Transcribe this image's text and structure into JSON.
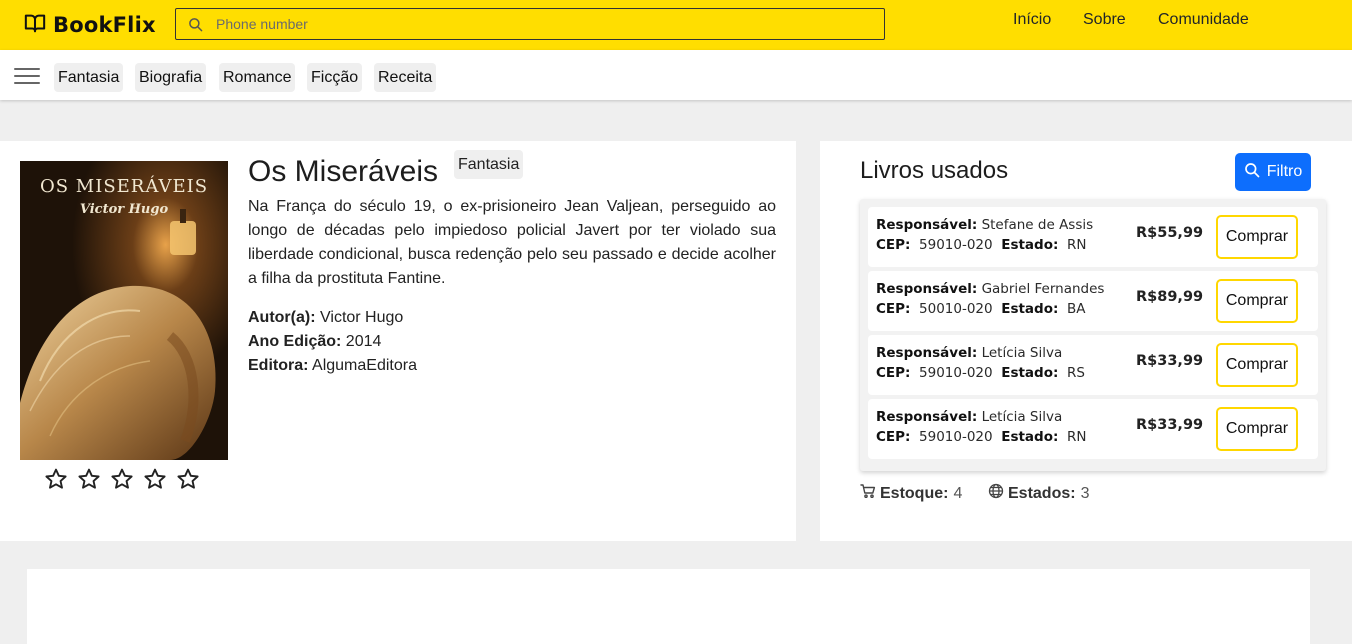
{
  "app": {
    "name": "BookFlix",
    "logo_icon": "book-open-icon"
  },
  "search": {
    "placeholder": "Phone number",
    "icon": "search-icon"
  },
  "topnav": [
    "Início",
    "Sobre",
    "Comunidade"
  ],
  "categories": [
    "Fantasia",
    "Biografia",
    "Romance",
    "Ficção",
    "Receita"
  ],
  "book": {
    "title": "Os Miseráveis",
    "genre": "Fantasia",
    "cover": {
      "title": "OS MISERÁVEIS",
      "author": "Victor Hugo"
    },
    "description": "Na França do século 19, o ex-prisioneiro Jean Valjean, perseguido ao longo de décadas pelo impiedoso policial Javert por ter violado sua liberdade condicional, busca redenção pelo seu passado e decide acolher a filha da prostituta Fantine.",
    "author_label": "Autor(a):",
    "author": "Victor Hugo",
    "year_label": "Ano Edição:",
    "year": "2014",
    "publisher_label": "Editora:",
    "publisher": "AlgumaEditora",
    "rating": {
      "value": 0,
      "max": 5
    }
  },
  "used": {
    "title": "Livros usados",
    "filter_label": "Filtro",
    "labels": {
      "owner": "Responsável:",
      "cep": "CEP:",
      "state": "Estado:"
    },
    "buy_label": "Comprar",
    "offers": [
      {
        "owner": "Stefane de Assis",
        "cep": "59010-020",
        "state": "RN",
        "price": "R$55,99"
      },
      {
        "owner": "Gabriel Fernandes",
        "cep": "50010-020",
        "state": "BA",
        "price": "R$89,99"
      },
      {
        "owner": "Letícia Silva",
        "cep": "59010-020",
        "state": "RS",
        "price": "R$33,99"
      },
      {
        "owner": "Letícia Silva",
        "cep": "59010-020",
        "state": "RN",
        "price": "R$33,99"
      }
    ],
    "stock_label": "Estoque:",
    "stock": "4",
    "states_label": "Estados:",
    "states": "3"
  },
  "colors": {
    "topbar": "#ffde00",
    "primary": "#0d6efd",
    "buy_border": "#ffd700",
    "background": "#efefef"
  }
}
